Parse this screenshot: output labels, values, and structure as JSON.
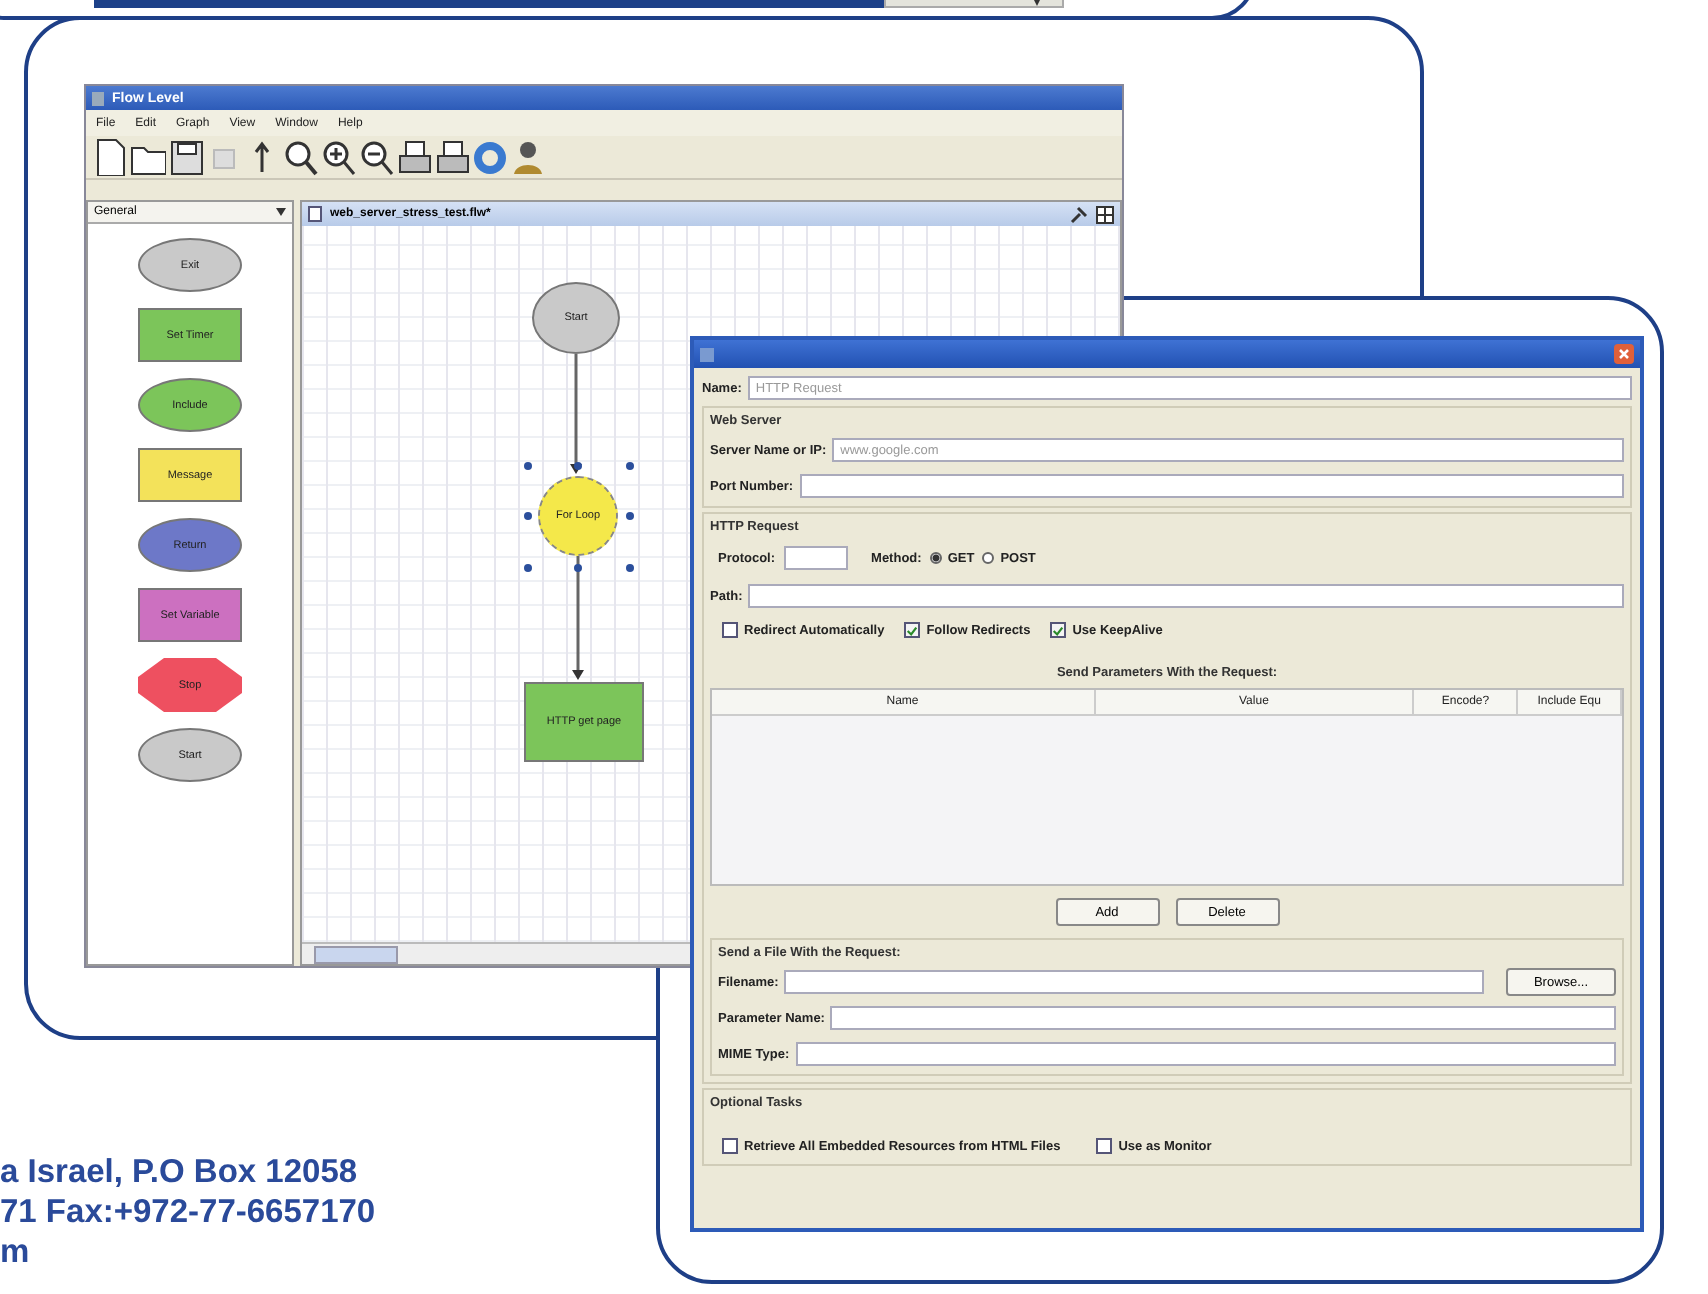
{
  "flow_window": {
    "title": "Flow Level",
    "menu": [
      "File",
      "Edit",
      "Graph",
      "View",
      "Window",
      "Help"
    ],
    "palette": {
      "category": "General",
      "items": [
        {
          "label": "Exit",
          "kind": "ellipse",
          "color": "#c9c9c9"
        },
        {
          "label": "Set Timer",
          "kind": "rect",
          "color": "#7cc55a"
        },
        {
          "label": "Include",
          "kind": "ellipse",
          "color": "#7cc55a"
        },
        {
          "label": "Message",
          "kind": "rect",
          "color": "#f3e25a"
        },
        {
          "label": "Return",
          "kind": "ellipse",
          "color": "#6d78c8"
        },
        {
          "label": "Set Variable",
          "kind": "rect",
          "color": "#cc70c0"
        },
        {
          "label": "Stop",
          "kind": "octagon",
          "color": "#ee5060"
        },
        {
          "label": "Start",
          "kind": "ellipse",
          "color": "#c9c9c9"
        }
      ]
    },
    "editor_tab": {
      "title": "web_server_stress_test.flw*"
    },
    "nodes": [
      {
        "label": "Start",
        "kind": "ellipse",
        "color": "#c9c9c9",
        "selected": false
      },
      {
        "label": "For Loop",
        "kind": "circle",
        "color": "#f4e84a",
        "selected": true
      },
      {
        "label": "HTTP get page",
        "kind": "rect",
        "color": "#7cc55a",
        "selected": false
      }
    ]
  },
  "dialog": {
    "name": {
      "label": "Name:",
      "value": "HTTP Request"
    },
    "web_server": {
      "title": "Web Server",
      "server": {
        "label": "Server Name or IP:",
        "value": "www.google.com"
      },
      "port": {
        "label": "Port Number:"
      }
    },
    "http_request": {
      "title": "HTTP Request",
      "protocol": {
        "label": "Protocol:"
      },
      "method": {
        "label": "Method:",
        "options": [
          {
            "label": "GET",
            "selected": true
          },
          {
            "label": "POST",
            "selected": false
          }
        ]
      },
      "path": {
        "label": "Path:"
      },
      "options": [
        {
          "label": "Redirect Automatically",
          "checked": false
        },
        {
          "label": "Follow Redirects",
          "checked": true
        },
        {
          "label": "Use KeepAlive",
          "checked": true
        }
      ]
    },
    "parameters": {
      "title": "Send Parameters With the Request:",
      "columns": [
        "Name",
        "Value",
        "Encode?",
        "Include Equ"
      ],
      "buttons": [
        "Add",
        "Delete"
      ]
    },
    "file": {
      "title": "Send a File With the Request:",
      "filename": {
        "label": "Filename:"
      },
      "browse": "Browse...",
      "param_name": {
        "label": "Parameter Name:"
      },
      "mime": {
        "label": "MIME Type:"
      }
    },
    "optional": {
      "title": "Optional Tasks",
      "options": [
        {
          "label": "Retrieve All Embedded Resources from HTML Files",
          "checked": false
        },
        {
          "label": "Use as Monitor",
          "checked": false
        }
      ]
    }
  },
  "contact": {
    "lines": [
      "a Israel, P.O Box 12058",
      "71 Fax:+972-77-6657170",
      "m"
    ]
  }
}
